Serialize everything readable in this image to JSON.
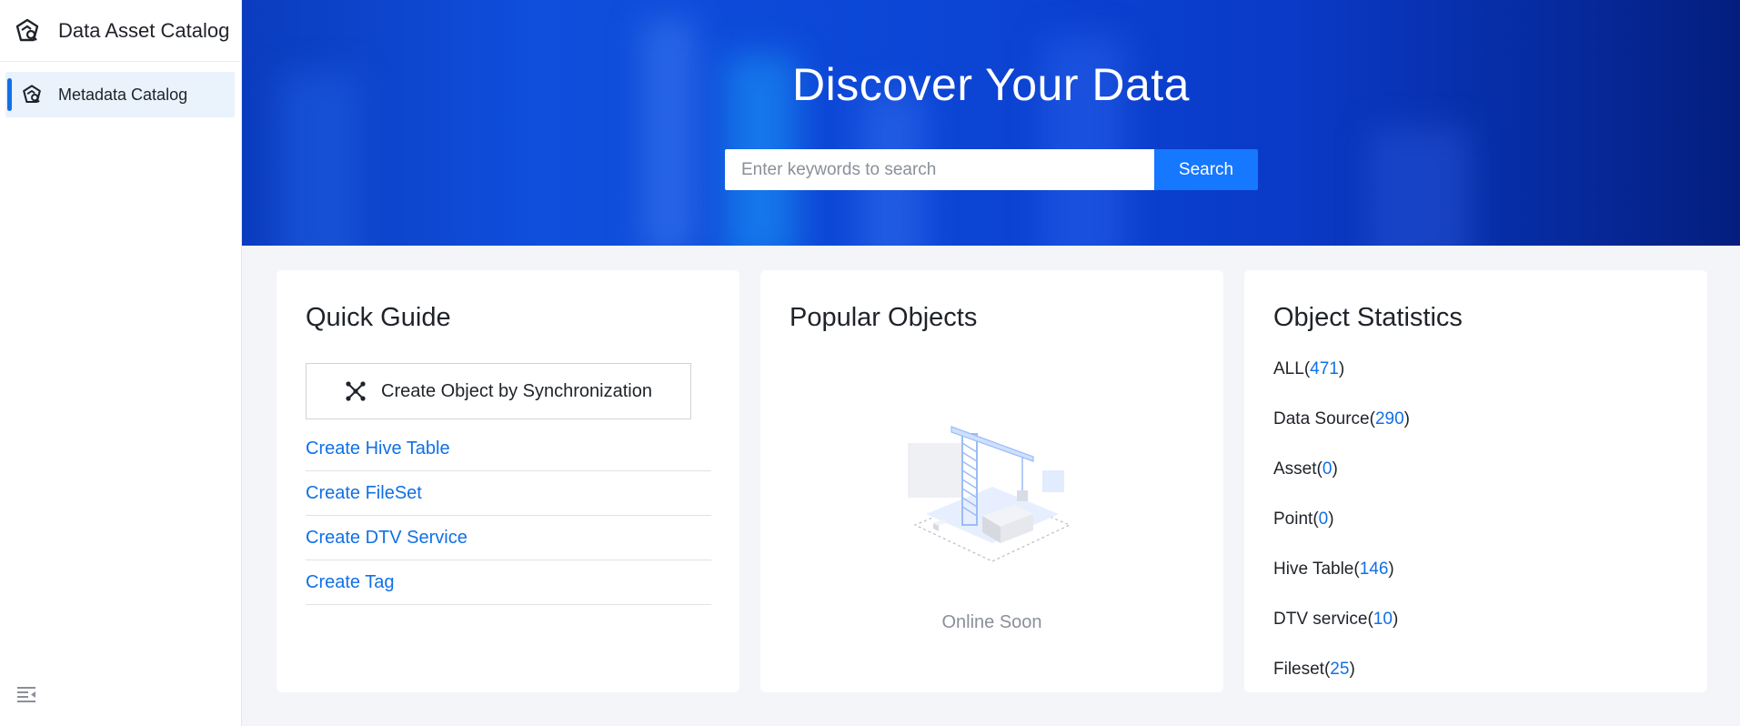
{
  "sidebar": {
    "app_title": "Data Asset Catalog",
    "menu_item": "Metadata Catalog"
  },
  "hero": {
    "title": "Discover Your Data",
    "search_placeholder": "Enter keywords to search",
    "search_button": "Search"
  },
  "quick_guide": {
    "title": "Quick Guide",
    "sync_button": "Create Object by Synchronization",
    "links": [
      "Create Hive Table",
      "Create FileSet",
      "Create DTV Service",
      "Create Tag"
    ]
  },
  "popular": {
    "title": "Popular Objects",
    "empty_text": "Online Soon"
  },
  "statistics": {
    "title": "Object Statistics",
    "items": [
      {
        "label": "ALL",
        "count": "471"
      },
      {
        "label": "Data Source",
        "count": "290"
      },
      {
        "label": "Asset",
        "count": "0"
      },
      {
        "label": "Point",
        "count": "0"
      },
      {
        "label": "Hive Table",
        "count": "146"
      },
      {
        "label": "DTV service",
        "count": "10"
      },
      {
        "label": "Fileset",
        "count": "25"
      }
    ]
  },
  "colors": {
    "accent": "#1677ff",
    "link": "#1170e6",
    "hero_start": "#0b3cbf",
    "hero_end": "#041e7e"
  },
  "icons": {
    "logo": "catalog-logo-icon",
    "menu": "catalog-icon",
    "sync": "network-nodes-icon",
    "collapse": "collapse-menu-icon"
  }
}
